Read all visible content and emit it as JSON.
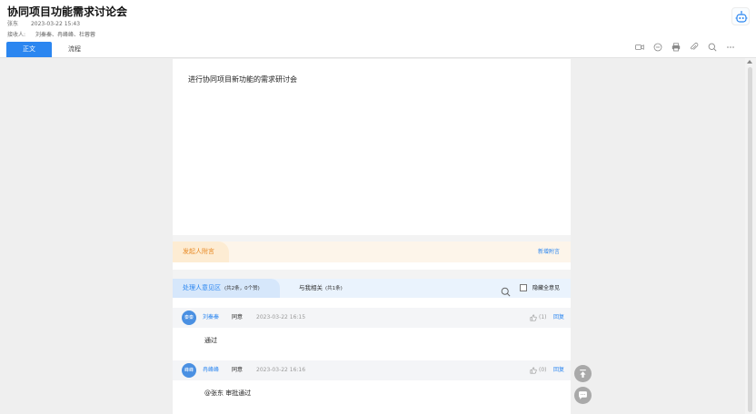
{
  "header": {
    "title": "协同项目功能需求讨论会",
    "sender": "张东",
    "sent_time": "2023-03-22 15:43",
    "recipients_label": "接收人:",
    "recipients": "刘秦秦、冉峰峰、杜蓉蓉",
    "tabs": [
      {
        "label": "正文",
        "active": true
      },
      {
        "label": "流程",
        "active": false
      }
    ],
    "toolbar_icons": [
      "video-icon",
      "comment-icon",
      "print-icon",
      "attachment-icon",
      "search-icon",
      "more-icon"
    ]
  },
  "document": {
    "body": "进行协同项目新功能的需求研讨会"
  },
  "sender_section": {
    "title": "发起人附言",
    "add_label": "新增附言"
  },
  "opinion_section": {
    "tab_label": "处理人意见区",
    "tab_count": "(共2条，0个赞)",
    "related_label": "与我相关",
    "related_count": "(共1条)",
    "hide_label": "隐藏全意见"
  },
  "comments": [
    {
      "avatar": "秦秦",
      "name": "刘秦秦",
      "status": "同意",
      "time": "2023-03-22 16:15",
      "likes": "(1)",
      "reply": "回复",
      "text": "通过"
    },
    {
      "avatar": "峰峰",
      "name": "冉峰峰",
      "status": "同意",
      "time": "2023-03-22 16:16",
      "likes": "(0)",
      "reply": "回复",
      "text": "@张东 审批通过"
    }
  ],
  "colors": {
    "accent": "#2b86f0",
    "sender_accent": "#e88a26",
    "fab": "#a9a9a9"
  }
}
